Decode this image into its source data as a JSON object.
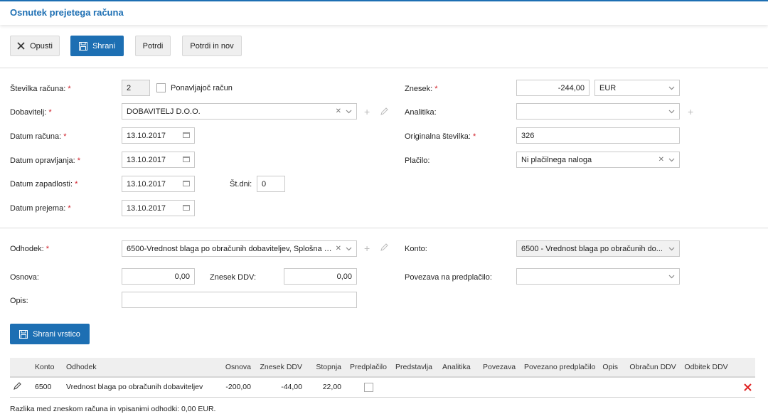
{
  "header": {
    "title": "Osnutek prejetega računa"
  },
  "toolbar": {
    "cancel": "Opusti",
    "save": "Shrani",
    "confirm": "Potrdi",
    "confirm_new": "Potrdi in nov"
  },
  "form": {
    "invoice_number_label": "Številka računa:",
    "invoice_number": "2",
    "recurring_label": "Ponavljajoč račun",
    "supplier_label": "Dobavitelj:",
    "supplier": "DOBAVITELJ D.O.O.",
    "invoice_date_label": "Datum računa:",
    "invoice_date": "13.10.2017",
    "service_date_label": "Datum opravljanja:",
    "service_date": "13.10.2017",
    "due_date_label": "Datum zapadlosti:",
    "due_date": "13.10.2017",
    "days_label": "Št.dni:",
    "days": "0",
    "receipt_date_label": "Datum prejema:",
    "receipt_date": "13.10.2017",
    "amount_label": "Znesek:",
    "amount": "-244,00",
    "currency": "EUR",
    "analytics_label": "Analitika:",
    "analytics": "",
    "original_number_label": "Originalna številka:",
    "original_number": "326",
    "payment_label": "Plačilo:",
    "payment": "Ni plačilnega naloga"
  },
  "line": {
    "expense_label": "Odhodek:",
    "expense": "6500-Vrednost blaga po obračunih dobaviteljev, Splošna s...",
    "account_label": "Konto:",
    "account": "6500 - Vrednost blaga po obračunih do...",
    "base_label": "Osnova:",
    "base": "0,00",
    "vat_amount_label": "Znesek DDV:",
    "vat_amount": "0,00",
    "prepayment_link_label": "Povezava na predplačilo:",
    "prepayment_link": "",
    "description_label": "Opis:",
    "description": "",
    "save_line": "Shrani vrstico"
  },
  "table": {
    "columns": [
      "Konto",
      "Odhodek",
      "Osnova",
      "Znesek DDV",
      "Stopnja",
      "Predplačilo",
      "Predstavlja",
      "Analitika",
      "Povezava",
      "Povezano predplačilo",
      "Opis",
      "Obračun DDV",
      "Odbitek DDV"
    ],
    "rows": [
      {
        "konto": "6500",
        "odhodek": "Vrednost blaga po obračunih dobaviteljev",
        "osnova": "-200,00",
        "ddv": "-44,00",
        "stopnja": "22,00"
      }
    ]
  },
  "footer": {
    "difference": "Razlika med zneskom računa in vpisanimi odhodki: 0,00 EUR."
  },
  "colors": {
    "accent": "#1d6fb3",
    "required": "#d0202a",
    "delete": "#e02424"
  }
}
